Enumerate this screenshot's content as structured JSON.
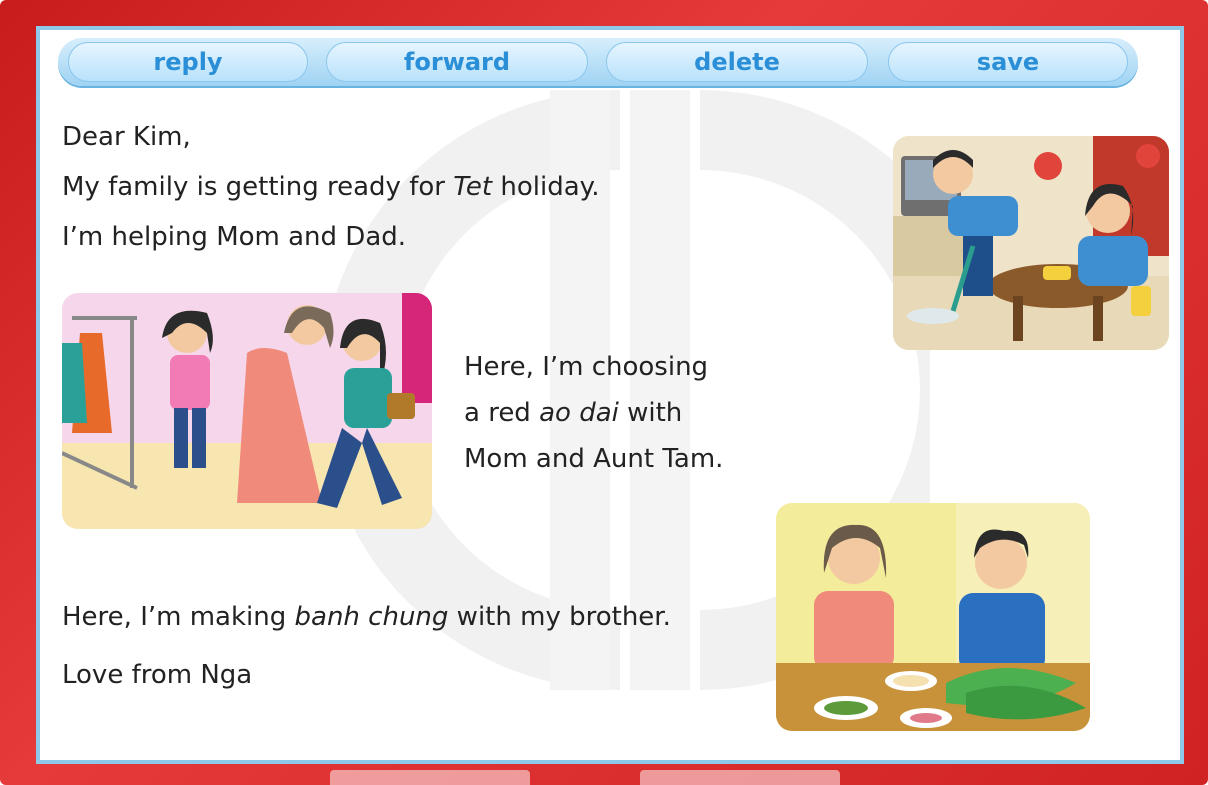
{
  "toolbar": {
    "reply_label": "reply",
    "forward_label": "forward",
    "delete_label": "delete",
    "save_label": "save"
  },
  "letter": {
    "greeting": "Dear Kim,",
    "line1_before": "My family is getting ready for ",
    "line1_italic": "Tet",
    "line1_after": " holiday.",
    "line2": "I’m helping Mom and Dad.",
    "caption1_line1": "Here, I’m choosing",
    "caption1_line2_before": "a red ",
    "caption1_line2_italic": "ao dai",
    "caption1_line2_after": " with",
    "caption1_line3": "Mom and Aunt Tam.",
    "caption2_before": "Here, I’m making ",
    "caption2_italic": "banh chung",
    "caption2_after": " with my brother.",
    "signoff": "Love from Nga"
  },
  "colors": {
    "frame": "#d32626",
    "panel_border": "#8fc9ea",
    "button_text": "#2a8fd6"
  },
  "images": {
    "cleaning": "illustration-cleaning",
    "shopping": "illustration-choosing-ao-dai",
    "cooking": "illustration-making-banh-chung"
  }
}
